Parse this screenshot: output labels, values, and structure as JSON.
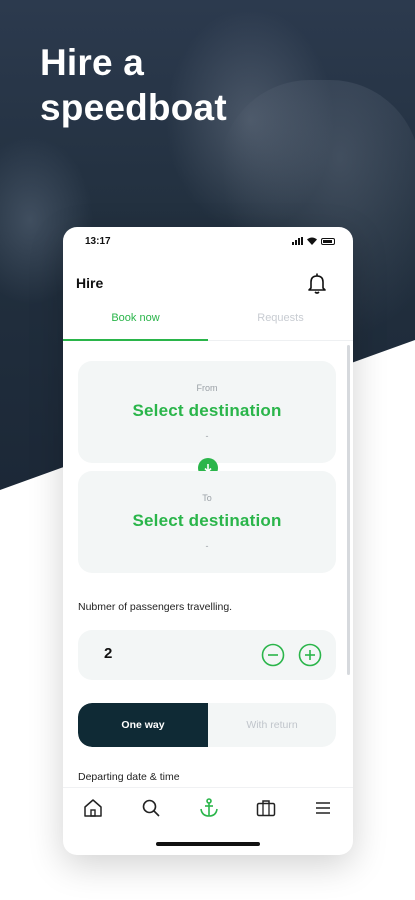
{
  "hero": {
    "title_line1": "Hire a",
    "title_line2": "speedboat"
  },
  "status_bar": {
    "time": "13:17"
  },
  "app_bar": {
    "title": "Hire",
    "bell_icon": "bell-icon"
  },
  "tabs": [
    {
      "label": "Book now",
      "active": true
    },
    {
      "label": "Requests",
      "active": false
    }
  ],
  "destinations": {
    "from_label": "From",
    "from_value": "Select destination",
    "from_detail": "-",
    "to_label": "To",
    "to_value": "Select destination",
    "to_detail": "-",
    "swap_icon": "arrow-down-icon"
  },
  "passengers": {
    "label": "Nubmer of passengers travelling.",
    "count": "2",
    "minus_icon": "minus-circle-icon",
    "plus_icon": "plus-circle-icon"
  },
  "trip_type": {
    "one_way": "One way",
    "with_return": "With return",
    "selected": "One way"
  },
  "departing": {
    "label": "Departing date & time"
  },
  "bottom_nav": [
    {
      "icon": "home-icon",
      "active": false
    },
    {
      "icon": "search-icon",
      "active": false
    },
    {
      "icon": "anchor-icon",
      "active": true
    },
    {
      "icon": "briefcase-icon",
      "active": false
    },
    {
      "icon": "menu-icon",
      "active": false
    }
  ],
  "colors": {
    "accent": "#2ab54a",
    "dark": "#0f2a35",
    "card_bg": "#f3f6f6",
    "hero_bg": "#22303f"
  }
}
